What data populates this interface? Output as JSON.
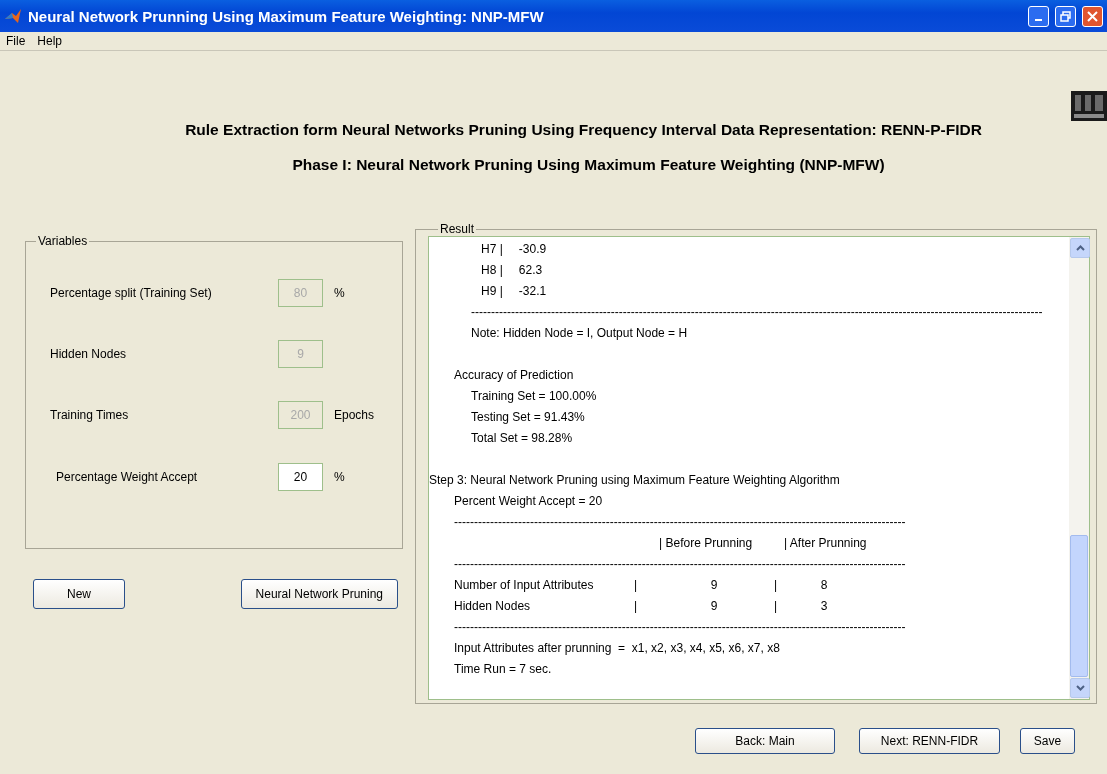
{
  "window": {
    "title": "Neural Network Prunning Using Maximum Feature Weighting: NNP-MFW"
  },
  "menu": [
    "File",
    "Help"
  ],
  "headings": [
    "Rule Extraction form Neural Networks Pruning Using Frequency Interval Data Representation: RENN-P-FIDR",
    "Phase I: Neural Network Pruning Using Maximum Feature Weighting (NNP-MFW)"
  ],
  "variables": {
    "title": "Variables",
    "fields": [
      {
        "label": "Percentage split (Training Set)",
        "value": "80",
        "unit": "%",
        "disabled": true
      },
      {
        "label": "Hidden Nodes",
        "value": "9",
        "disabled": true
      },
      {
        "label": "Training Times",
        "value": "200",
        "unit": "Epochs",
        "disabled": true
      },
      {
        "label": "Percentage Weight Accept",
        "value": "20",
        "unit": "%",
        "disabled": false
      }
    ]
  },
  "left_buttons": [
    "New",
    "Neural Network Pruning"
  ],
  "result": {
    "title": "Result",
    "lines": [
      {
        "kind": "pair",
        "cells": [
          "H7 |",
          "-30.9"
        ]
      },
      {
        "kind": "pair",
        "cells": [
          "H8 |",
          "62.3"
        ]
      },
      {
        "kind": "pair",
        "cells": [
          "H9 |",
          "-32.1"
        ]
      },
      {
        "kind": "rule",
        "text": "-----------------------------------------------------------------------------------------------------------------------------------------------"
      },
      {
        "kind": "note",
        "text": "Note: Hidden Node = I, Output Node = H"
      },
      {
        "kind": "blank"
      },
      {
        "kind": "section",
        "text": "Accuracy of Prediction"
      },
      {
        "kind": "note",
        "text": "Training Set = 100.00%"
      },
      {
        "kind": "note",
        "text": "Testing Set = 91.43%"
      },
      {
        "kind": "note",
        "text": "Total Set = 98.28%"
      },
      {
        "kind": "blank"
      },
      {
        "kind": "step",
        "text": "Step 3: Neural Network Pruning using Maximum Feature Weighting Algorithm"
      },
      {
        "kind": "section",
        "text": "Percent Weight Accept = 20"
      },
      {
        "kind": "srule",
        "text": "-----------------------------------------------------------------------------------------------------------------"
      },
      {
        "kind": "row",
        "cells": [
          "",
          "| Before Prunning",
          "| After Prunning"
        ]
      },
      {
        "kind": "srule",
        "text": "-----------------------------------------------------------------------------------------------------------------"
      },
      {
        "kind": "row",
        "cells": [
          "Number of Input Attributes",
          "|",
          "9",
          "|",
          "8"
        ]
      },
      {
        "kind": "row",
        "cells": [
          "Hidden Nodes",
          "|",
          "9",
          "|",
          "3"
        ]
      },
      {
        "kind": "srule",
        "text": "-----------------------------------------------------------------------------------------------------------------"
      },
      {
        "kind": "section",
        "text": "Input Attributes after prunning  =  x1, x2, x3, x4, x5, x6, x7, x8"
      },
      {
        "kind": "section",
        "text": "Time Run = 7 sec."
      }
    ]
  },
  "bottom_buttons": [
    "Back: Main",
    "Next: RENN-FIDR",
    "Save"
  ]
}
